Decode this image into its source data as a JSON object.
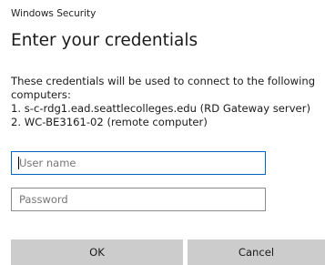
{
  "window": {
    "title": "Windows Security"
  },
  "dialog": {
    "heading": "Enter your credentials",
    "description_lines": [
      "These credentials will be used to connect to the following",
      "computers:",
      "1. s-c-rdg1.ead.seattlecolleges.edu (RD Gateway server)",
      "2. WC-BE3161-02 (remote computer)"
    ]
  },
  "form": {
    "username": {
      "value": "",
      "placeholder": "User name"
    },
    "password": {
      "value": "",
      "placeholder": "Password"
    }
  },
  "buttons": {
    "ok_label": "OK",
    "cancel_label": "Cancel"
  },
  "colors": {
    "focus_border": "#0067c0",
    "button_bg": "#cccccc"
  }
}
